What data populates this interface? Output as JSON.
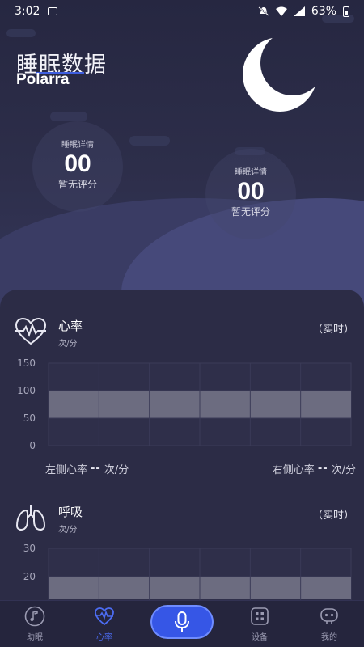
{
  "status_bar": {
    "time": "3:02",
    "battery": "63%"
  },
  "header": {
    "title": "睡眠数据",
    "subtitle": "Polarra"
  },
  "scores": [
    {
      "label": "睡眠详情",
      "value": "00",
      "note": "暂无评分"
    },
    {
      "label": "睡眠详情",
      "value": "00",
      "note": "暂无评分"
    }
  ],
  "heart_rate": {
    "title": "心率",
    "unit": "次/分",
    "mode": "（实时）",
    "left_label": "左侧心率",
    "left_value": "--",
    "left_unit": "次/分",
    "right_label": "右侧心率",
    "right_value": "--",
    "right_unit": "次/分"
  },
  "breathing": {
    "title": "呼吸",
    "unit": "次/分",
    "mode": "（实时）"
  },
  "chart_data": [
    {
      "type": "area",
      "ylabel": "",
      "ylim": [
        0,
        150
      ],
      "yticks": [
        "150",
        "100",
        "50",
        "0"
      ],
      "band": [
        50,
        100
      ],
      "series": []
    },
    {
      "type": "area",
      "ylabel": "",
      "ylim": [
        10,
        30
      ],
      "yticks": [
        "30",
        "20"
      ],
      "band": [
        12,
        20
      ],
      "series": []
    }
  ],
  "nav": {
    "items": [
      {
        "label": "助眠",
        "icon": "music-note-icon"
      },
      {
        "label": "心率",
        "icon": "heart-pulse-icon"
      },
      {
        "label": "设备",
        "icon": "device-grid-icon"
      },
      {
        "label": "我的",
        "icon": "robot-face-icon"
      }
    ],
    "active": "心率",
    "mic_icon": "microphone-icon"
  },
  "colors": {
    "accent": "#3656e6",
    "background": "#2b2b45",
    "band": "#777789"
  }
}
